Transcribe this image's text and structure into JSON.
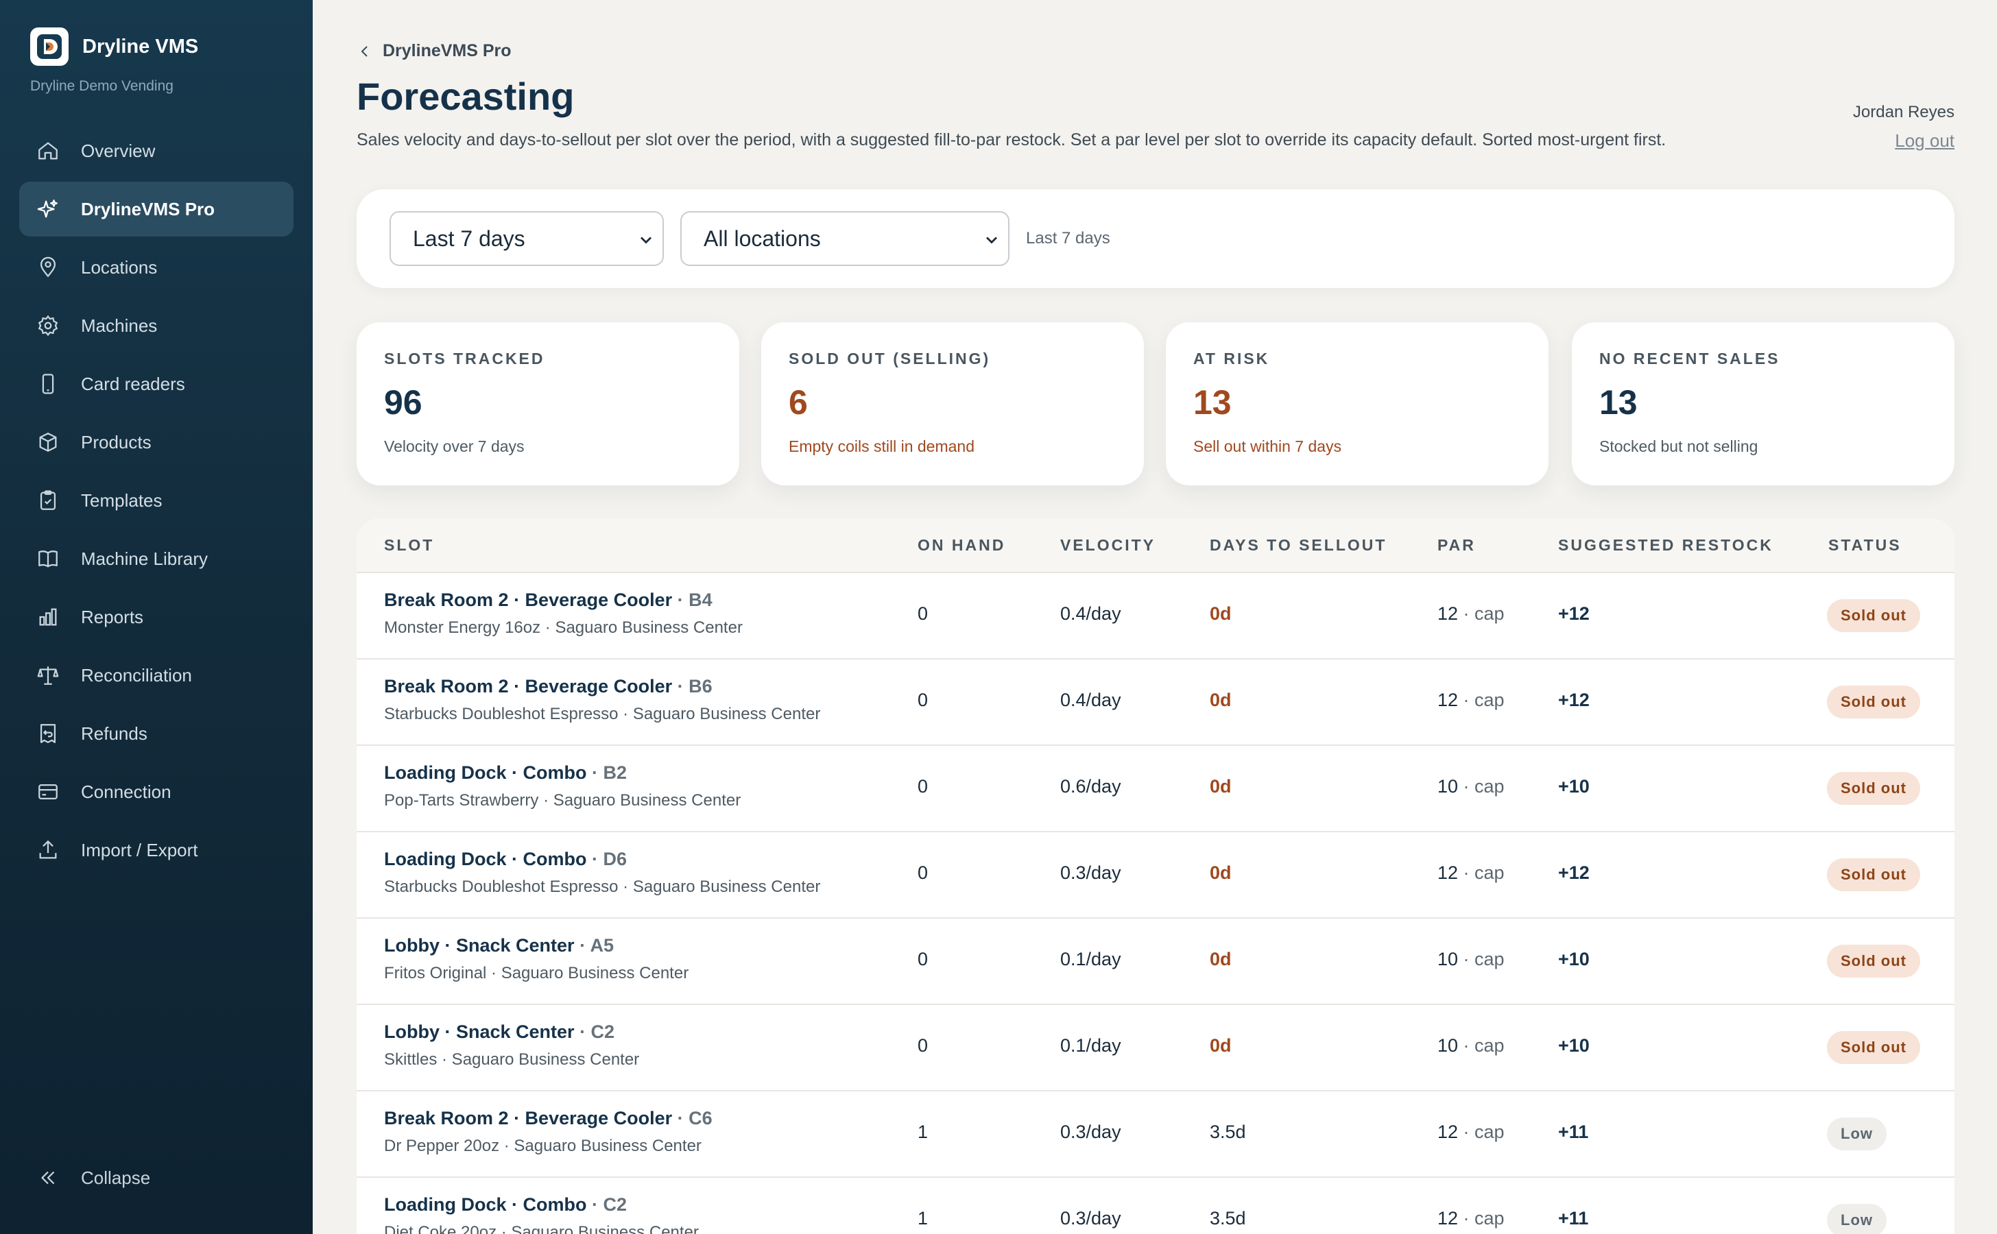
{
  "sidebar": {
    "brand_name": "Dryline VMS",
    "brand_sub": "Dryline Demo Vending",
    "items": [
      {
        "label": "Overview",
        "icon": "home-icon"
      },
      {
        "label": "DrylineVMS Pro",
        "icon": "sparkle-icon",
        "active": true
      },
      {
        "label": "Locations",
        "icon": "map-pin-icon"
      },
      {
        "label": "Machines",
        "icon": "gear-icon"
      },
      {
        "label": "Card readers",
        "icon": "phone-icon"
      },
      {
        "label": "Products",
        "icon": "box-icon"
      },
      {
        "label": "Templates",
        "icon": "clipboard-icon"
      },
      {
        "label": "Machine Library",
        "icon": "book-icon"
      },
      {
        "label": "Reports",
        "icon": "bar-chart-icon"
      },
      {
        "label": "Reconciliation",
        "icon": "scale-icon"
      },
      {
        "label": "Refunds",
        "icon": "receipt-icon"
      },
      {
        "label": "Connection",
        "icon": "credit-card-icon"
      },
      {
        "label": "Import / Export",
        "icon": "upload-icon"
      }
    ],
    "collapse_label": "Collapse"
  },
  "header": {
    "breadcrumb": "DrylineVMS Pro",
    "title": "Forecasting",
    "subtitle": "Sales velocity and days-to-sellout per slot over the period, with a suggested fill-to-par restock. Set a par level per slot to override its capacity default. Sorted most-urgent first.",
    "user_name": "Jordan Reyes",
    "logout_label": "Log out"
  },
  "filters": {
    "period_value": "Last 7 days",
    "location_value": "All locations",
    "period_note": "Last 7 days"
  },
  "stats": [
    {
      "label": "SLOTS TRACKED",
      "value": "96",
      "note": "Velocity over 7 days",
      "warn": false
    },
    {
      "label": "SOLD OUT (SELLING)",
      "value": "6",
      "note": "Empty coils still in demand",
      "warn": true
    },
    {
      "label": "AT RISK",
      "value": "13",
      "note": "Sell out within 7 days",
      "warn": true
    },
    {
      "label": "NO RECENT SALES",
      "value": "13",
      "note": "Stocked but not selling",
      "warn": false
    }
  ],
  "table": {
    "headers": {
      "slot": "SLOT",
      "on_hand": "ON HAND",
      "velocity": "VELOCITY",
      "days": "DAYS TO SELLOUT",
      "par": "PAR",
      "restock": "SUGGESTED RESTOCK",
      "status": "STATUS"
    },
    "rows": [
      {
        "title": "Break Room 2 · Beverage Cooler",
        "code": " · B4",
        "sub": "Monster Energy 16oz · Saguaro Business Center",
        "on_hand": "0",
        "velocity": "0.4/day",
        "days": "0d",
        "par": "12",
        "cap": " · cap",
        "restock": "+12",
        "status": "Sold out",
        "status_kind": "soldout"
      },
      {
        "title": "Break Room 2 · Beverage Cooler",
        "code": " · B6",
        "sub": "Starbucks Doubleshot Espresso · Saguaro Business Center",
        "on_hand": "0",
        "velocity": "0.4/day",
        "days": "0d",
        "par": "12",
        "cap": " · cap",
        "restock": "+12",
        "status": "Sold out",
        "status_kind": "soldout"
      },
      {
        "title": "Loading Dock · Combo",
        "code": " · B2",
        "sub": "Pop-Tarts Strawberry · Saguaro Business Center",
        "on_hand": "0",
        "velocity": "0.6/day",
        "days": "0d",
        "par": "10",
        "cap": " · cap",
        "restock": "+10",
        "status": "Sold out",
        "status_kind": "soldout"
      },
      {
        "title": "Loading Dock · Combo",
        "code": " · D6",
        "sub": "Starbucks Doubleshot Espresso · Saguaro Business Center",
        "on_hand": "0",
        "velocity": "0.3/day",
        "days": "0d",
        "par": "12",
        "cap": " · cap",
        "restock": "+12",
        "status": "Sold out",
        "status_kind": "soldout"
      },
      {
        "title": "Lobby · Snack Center",
        "code": " · A5",
        "sub": "Fritos Original · Saguaro Business Center",
        "on_hand": "0",
        "velocity": "0.1/day",
        "days": "0d",
        "par": "10",
        "cap": " · cap",
        "restock": "+10",
        "status": "Sold out",
        "status_kind": "soldout"
      },
      {
        "title": "Lobby · Snack Center",
        "code": " · C2",
        "sub": "Skittles · Saguaro Business Center",
        "on_hand": "0",
        "velocity": "0.1/day",
        "days": "0d",
        "par": "10",
        "cap": " · cap",
        "restock": "+10",
        "status": "Sold out",
        "status_kind": "soldout"
      },
      {
        "title": "Break Room 2 · Beverage Cooler",
        "code": " · C6",
        "sub": "Dr Pepper 20oz · Saguaro Business Center",
        "on_hand": "1",
        "velocity": "0.3/day",
        "days": "3.5d",
        "par": "12",
        "cap": " · cap",
        "restock": "+11",
        "status": "Low",
        "status_kind": "low"
      },
      {
        "title": "Loading Dock · Combo",
        "code": " · C2",
        "sub": "Diet Coke 20oz · Saguaro Business Center",
        "on_hand": "1",
        "velocity": "0.3/day",
        "days": "3.5d",
        "par": "12",
        "cap": " · cap",
        "restock": "+11",
        "status": "Low",
        "status_kind": "low"
      }
    ]
  },
  "colors": {
    "sidebar": "#17394d",
    "active_nav": "#2b4d61",
    "warn": "#a0491e",
    "badge_soldout_bg": "#f7e3d7",
    "badge_low_bg": "#efeeeb"
  }
}
